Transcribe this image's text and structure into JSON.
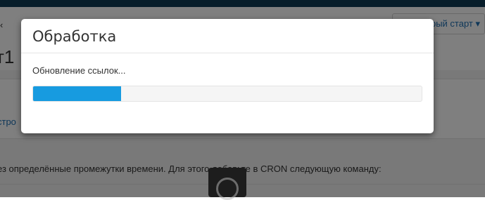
{
  "background": {
    "quickstart_label": "Быстрый старт ▾",
    "page_title": "т1",
    "link_text": "стро",
    "description": "ез определённые промежутки времени. Для этого добавьте в CRON следующую команду:",
    "left_nav_glyph": "‹"
  },
  "modal": {
    "title": "Обработка",
    "status": "Обновление ссылок...",
    "progress_fraction": 0.227,
    "progress_color": "#179be0"
  }
}
